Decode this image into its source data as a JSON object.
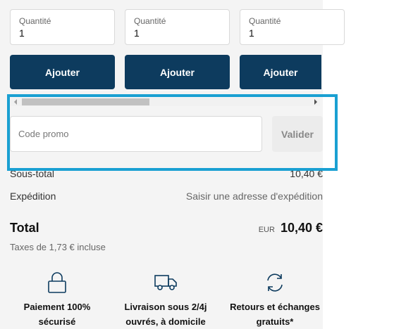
{
  "products": [
    {
      "quantity_label": "Quantité",
      "quantity_value": "1",
      "add_label": "Ajouter"
    },
    {
      "quantity_label": "Quantité",
      "quantity_value": "1",
      "add_label": "Ajouter"
    },
    {
      "quantity_label": "Quantité",
      "quantity_value": "1",
      "add_label": "Ajouter"
    }
  ],
  "promo": {
    "placeholder": "Code promo",
    "submit_label": "Valider"
  },
  "summary": {
    "subtotal_label": "Sous-total",
    "subtotal_value": "10,40 €",
    "shipping_label": "Expédition",
    "shipping_value": "Saisir une adresse d'expédition",
    "total_label": "Total",
    "currency": "EUR",
    "total_value": "10,40 €",
    "taxes_note": "Taxes de 1,73 € incluse"
  },
  "features": [
    {
      "icon": "lock-icon",
      "line1": "Paiement 100%",
      "line2": "sécurisé"
    },
    {
      "icon": "truck-icon",
      "line1": "Livraison sous 2/4j",
      "line2": "ouvrés, à domicile"
    },
    {
      "icon": "exchange-icon",
      "line1": "Retours et échanges",
      "line2": "gratuits*"
    }
  ],
  "colors": {
    "primary": "#0d3b5e",
    "highlight": "#1aa0d2",
    "background": "#f4f4f4"
  }
}
